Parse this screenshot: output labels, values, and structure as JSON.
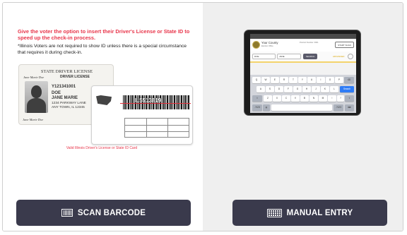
{
  "left_panel": {
    "instruction": "Give the voter the option to insert their Driver's License or State ID to speed up the check-in process.",
    "note": "*Illinois Voters are not required to show ID unless there is a special circumstance that requires it during check-in.",
    "id_card": {
      "title": "STATE DRIVER LICENSE",
      "subtitle": "DRIVER LICENSE",
      "signature": "Jane Marie Doe",
      "number": "Y121341001",
      "last_name": "DOE",
      "first_name": "JANE MARIE",
      "address": "1234 PARKWAY LANE",
      "city": "ANY TOWN, IL 12345",
      "barcode_text": "IL5513819"
    },
    "caption": "Valid Illinois Driver's License or State ID Card",
    "scan_button_label": "SCAN BARCODE"
  },
  "right_panel": {
    "tablet": {
      "app_name": "Your County",
      "app_sub": "Election Office",
      "precinct": "Precinct Number: 0001",
      "start_button": "START SCAN",
      "last_name_value": "DOE",
      "first_name_value": "JANE",
      "search_button": "SEARCH",
      "advanced_label": "ADVANCED",
      "keyboard_rows": [
        [
          "Q",
          "W",
          "E",
          "R",
          "T",
          "Y",
          "U",
          "I",
          "O",
          "P"
        ],
        [
          "A",
          "S",
          "D",
          "F",
          "G",
          "H",
          "J",
          "K",
          "L"
        ],
        [
          "Z",
          "X",
          "C",
          "V",
          "B",
          "N",
          "M"
        ]
      ],
      "search_key": "Search",
      "num_key": ".?123"
    },
    "manual_button_label": "MANUAL ENTRY"
  },
  "colors": {
    "accent_red": "#e8364b",
    "button_bg": "#3a3a4c",
    "right_bg": "#efefef"
  }
}
